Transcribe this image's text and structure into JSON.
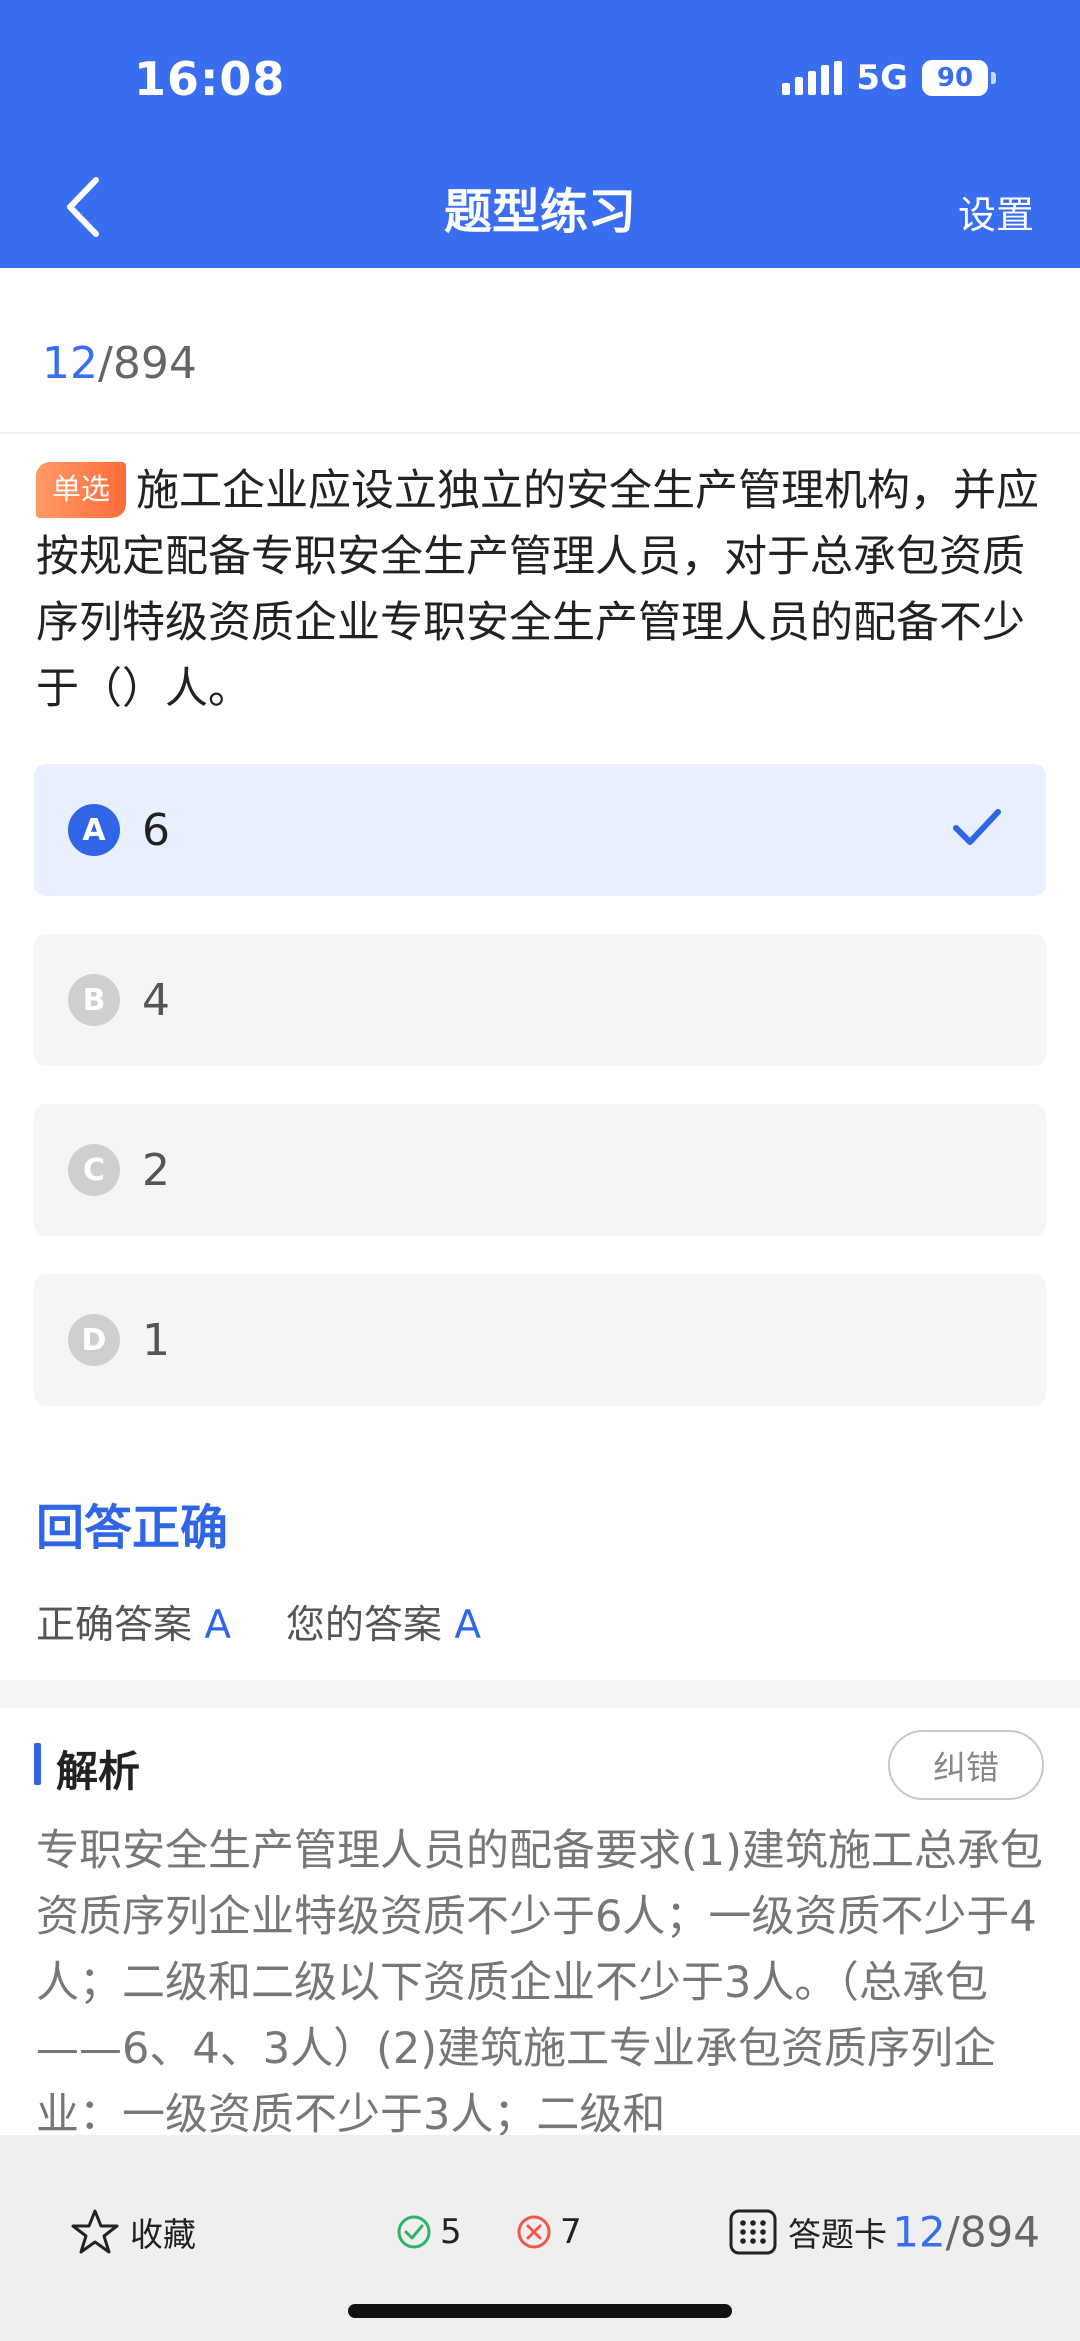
{
  "status_bar": {
    "time": "16:08",
    "network": "5G",
    "battery": "90"
  },
  "header": {
    "title": "题型练习",
    "settings_label": "设置"
  },
  "progress": {
    "current": "12",
    "total": "/894"
  },
  "question": {
    "type_tag": "单选",
    "text": "施工企业应设立独立的安全生产管理机构，并应按规定配备专职安全生产管理人员，对于总承包资质序列特级资质企业专职安全生产管理人员的配备不少于（）人。"
  },
  "options": [
    {
      "letter": "A",
      "text": "6",
      "selected": true
    },
    {
      "letter": "B",
      "text": "4",
      "selected": false
    },
    {
      "letter": "C",
      "text": "2",
      "selected": false
    },
    {
      "letter": "D",
      "text": "1",
      "selected": false
    }
  ],
  "result": {
    "title": "回答正确",
    "correct_label": "正确答案",
    "correct_value": "A",
    "yours_label": "您的答案",
    "yours_value": "A"
  },
  "analysis": {
    "title": "解析",
    "report_label": "纠错",
    "text": "专职安全生产管理人员的配备要求(1)建筑施工总承包资质序列企业特级资质不少于6人；一级资质不少于4人；二级和二级以下资质企业不少于3人。（总承包——6、4、3人）(2)建筑施工专业承包资质序列企业：一级资质不少于3人；二级和"
  },
  "bottom_bar": {
    "favorite_label": "收藏",
    "right_count": "5",
    "wrong_count": "7",
    "card_label": "答题卡",
    "current": "12",
    "total": "/894"
  },
  "colors": {
    "primary": "#3a6ef0",
    "accent_blue": "#2f66e8",
    "tag_orange": "#ff7a45",
    "right_green": "#2fb36b",
    "wrong_red": "#f0594a"
  }
}
